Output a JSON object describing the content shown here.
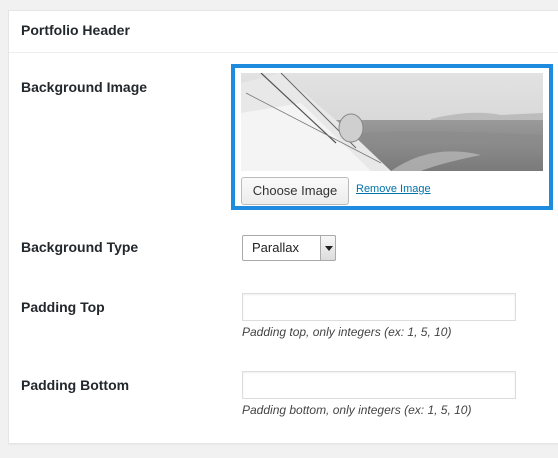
{
  "metabox": {
    "title": "Portfolio Header"
  },
  "background_image": {
    "label": "Background Image",
    "choose_label": "Choose Image",
    "remove_label": "Remove Image",
    "highlight_color": "#1e8cde"
  },
  "background_type": {
    "label": "Background Type",
    "selected": "Parallax"
  },
  "padding_top": {
    "label": "Padding Top",
    "value": "",
    "hint": "Padding top, only integers (ex: 1, 5, 10)"
  },
  "padding_bottom": {
    "label": "Padding Bottom",
    "value": "",
    "hint": "Padding bottom, only integers (ex: 1, 5, 10)"
  }
}
